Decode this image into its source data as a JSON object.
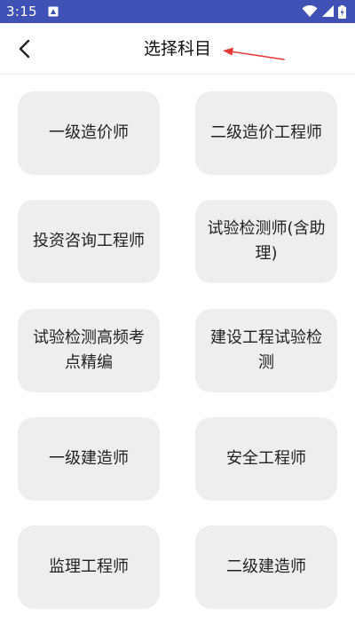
{
  "status_bar": {
    "time": "3:15",
    "notification_icon": "app-notification-icon",
    "icons": [
      "wifi-icon",
      "signal-icon",
      "battery-charging-icon"
    ]
  },
  "header": {
    "title": "选择科目",
    "back_icon": "chevron-left-icon",
    "annotation": "red-arrow-icon"
  },
  "subjects": [
    {
      "label": "一级造价师"
    },
    {
      "label": "二级造价工程师"
    },
    {
      "label": "投资咨询工程师"
    },
    {
      "label": "试验检测师(含助理)"
    },
    {
      "label": "试验检测高频考点精编"
    },
    {
      "label": "建设工程试验检测"
    },
    {
      "label": "一级建造师"
    },
    {
      "label": "安全工程师"
    },
    {
      "label": "监理工程师"
    },
    {
      "label": "二级建造师"
    }
  ],
  "colors": {
    "status_bar": "#3f51b5",
    "card_background": "#eeeeee",
    "annotation": "#e53935"
  }
}
